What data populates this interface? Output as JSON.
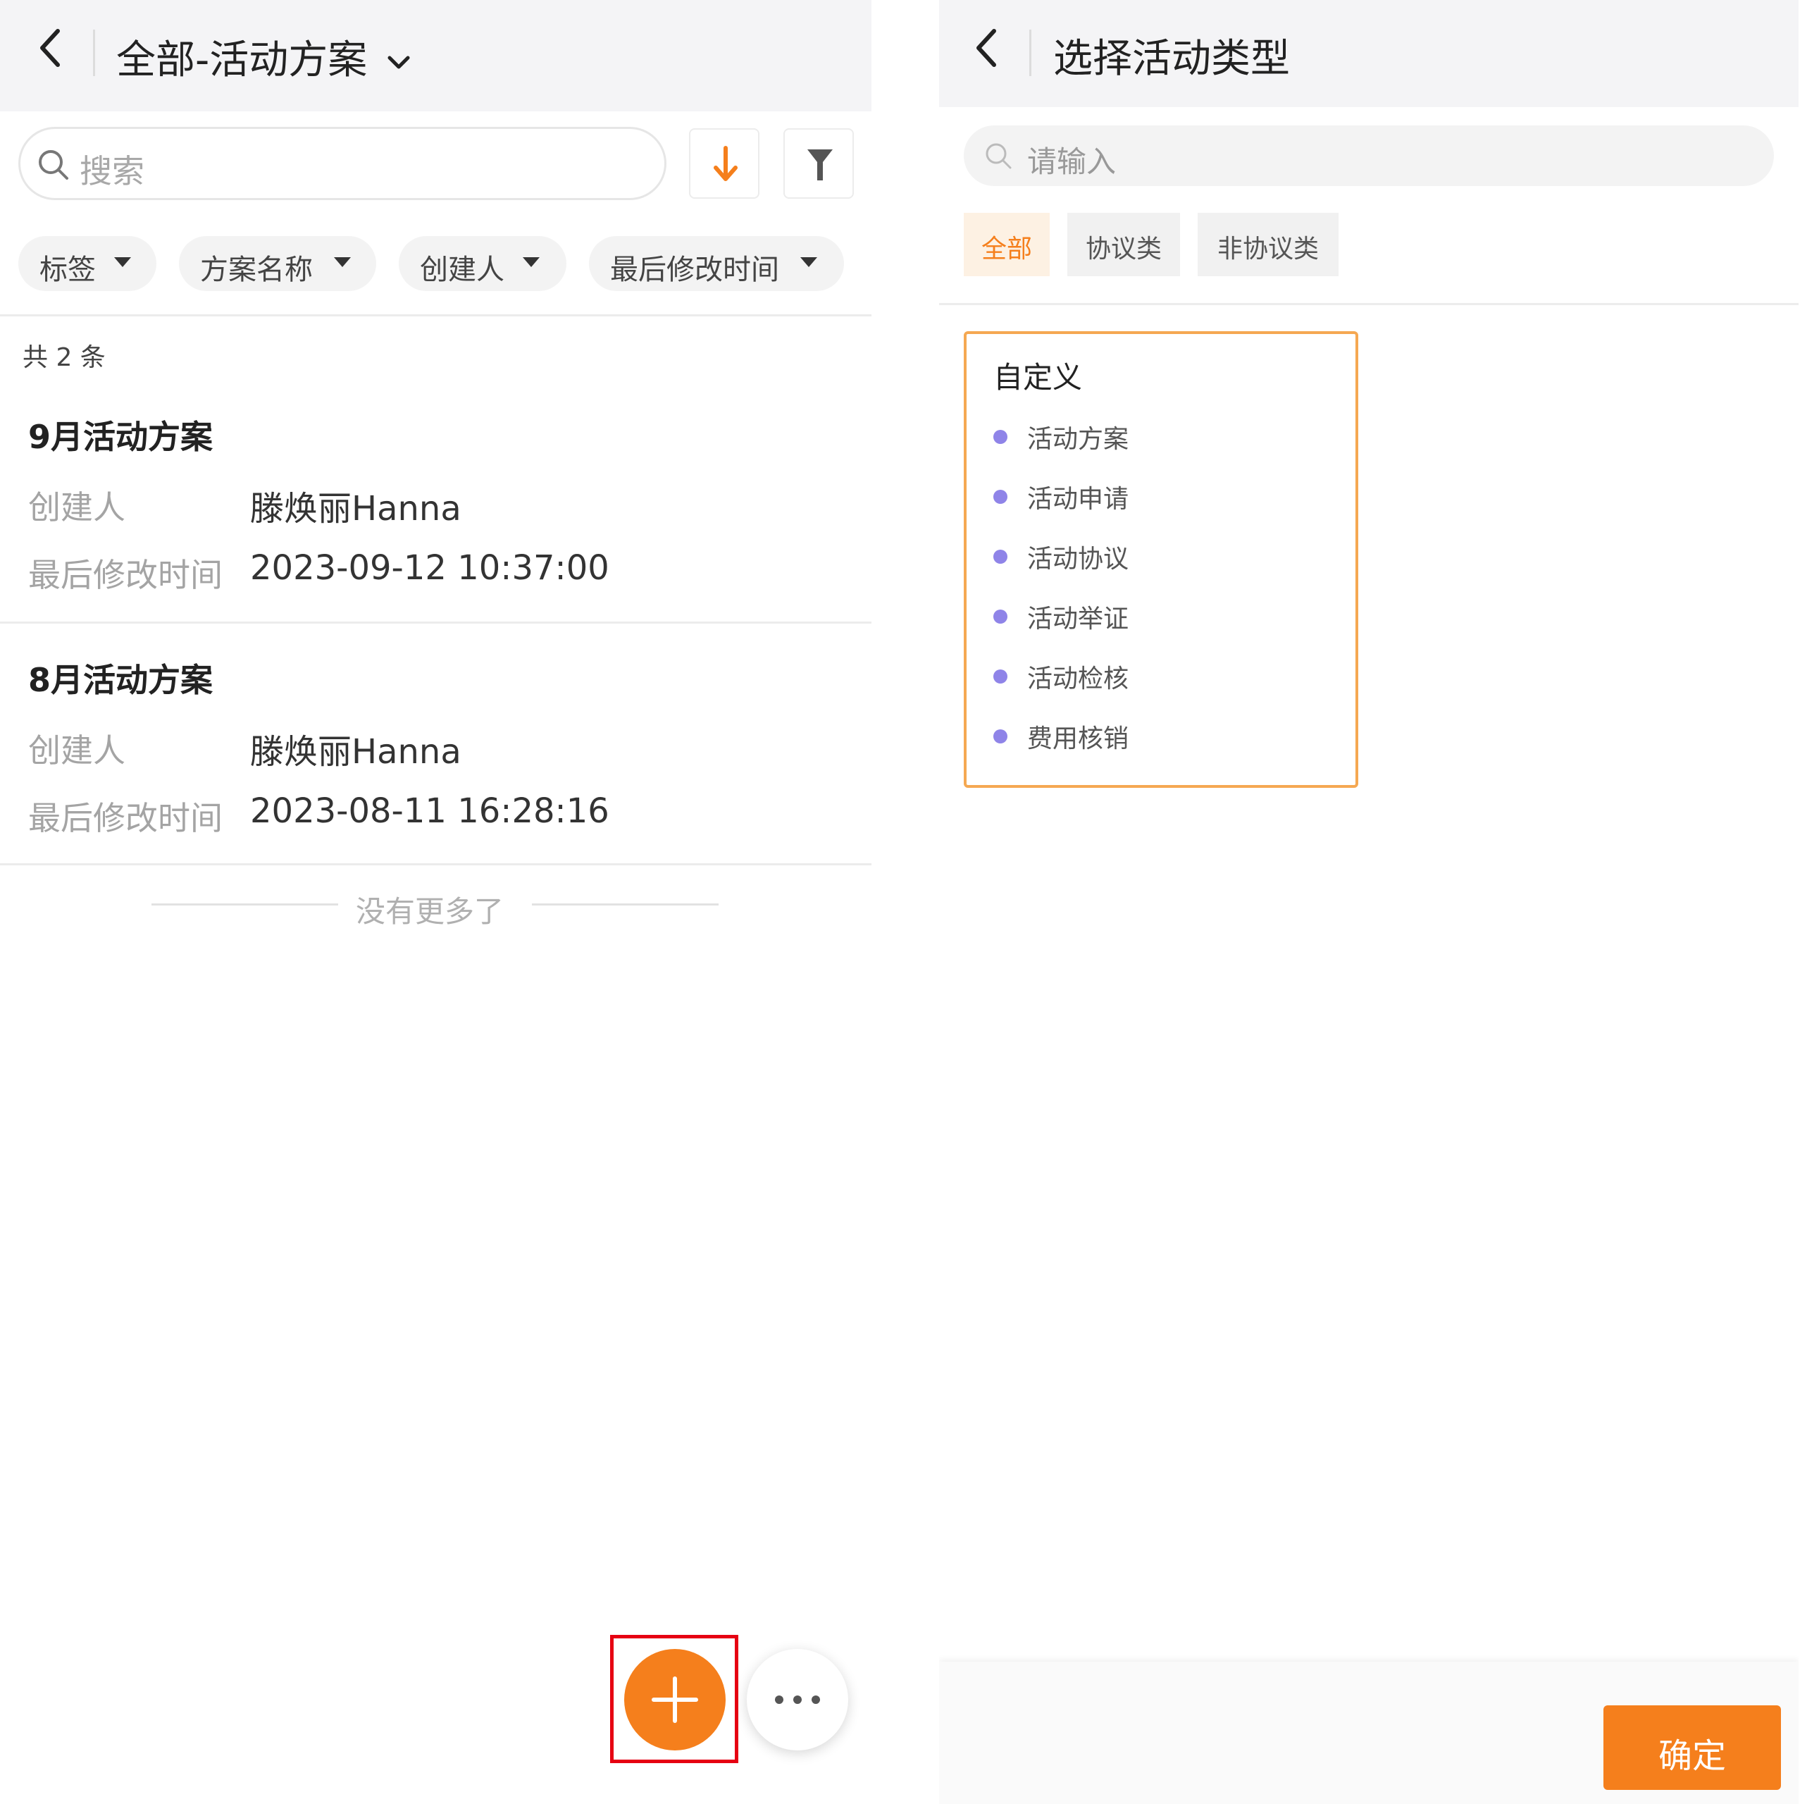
{
  "left": {
    "header": {
      "title": "全部-活动方案"
    },
    "search": {
      "placeholder": "搜索"
    },
    "filters": [
      {
        "label": "标签"
      },
      {
        "label": "方案名称"
      },
      {
        "label": "创建人"
      },
      {
        "label": "最后修改时间"
      }
    ],
    "count_text": "共 2 条",
    "records": [
      {
        "title": "9月活动方案",
        "creator_label": "创建人",
        "creator": "滕焕丽Hanna",
        "modified_label": "最后修改时间",
        "modified": "2023-09-12 10:37:00"
      },
      {
        "title": "8月活动方案",
        "creator_label": "创建人",
        "creator": "滕焕丽Hanna",
        "modified_label": "最后修改时间",
        "modified": "2023-08-11 16:28:16"
      }
    ],
    "end_text": "没有更多了",
    "colors": {
      "accent": "#f57f1c",
      "highlight": "#e60012"
    }
  },
  "right": {
    "header": {
      "title": "选择活动类型"
    },
    "search": {
      "placeholder": "请输入"
    },
    "tabs": [
      {
        "label": "全部",
        "active": true
      },
      {
        "label": "协议类",
        "active": false
      },
      {
        "label": "非协议类",
        "active": false
      }
    ],
    "group": {
      "title": "自定义",
      "items": [
        "活动方案",
        "活动申请",
        "活动协议",
        "活动举证",
        "活动检核",
        "费用核销"
      ]
    },
    "confirm_label": "确定",
    "colors": {
      "accent": "#f57f1c",
      "dot": "#8f84e8",
      "selected_border": "#f5a852"
    }
  }
}
